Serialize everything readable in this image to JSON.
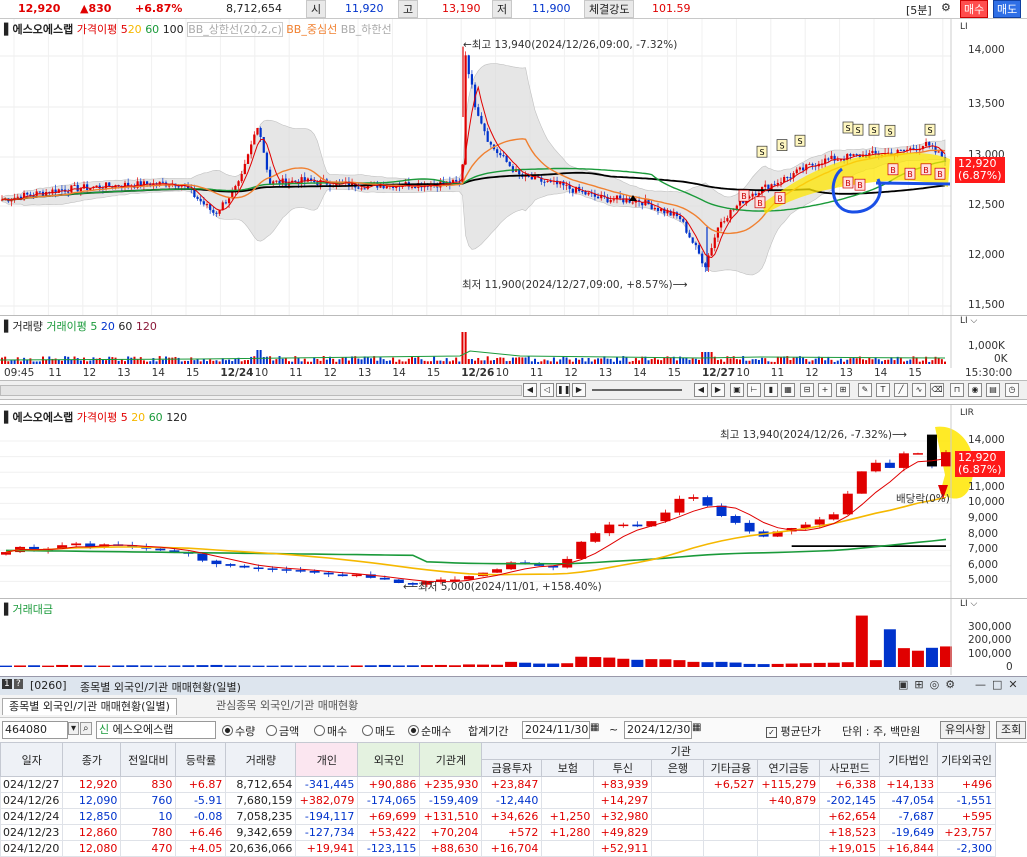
{
  "topbar": {
    "price": "12,920",
    "change": "▲830",
    "change_pct": "+6.87%",
    "volume": "8,712,654",
    "open_label": "시",
    "open": "11,920",
    "high_label": "고",
    "high": "13,190",
    "low_label": "저",
    "low": "11,900",
    "strength_label": "체결강도",
    "strength": "101.59",
    "period": "[5분]",
    "buy": "매수",
    "sell": "매도"
  },
  "chart1": {
    "legend": {
      "name": "에스오에스랩",
      "ma_label": "가격이평",
      "ma5": "5",
      "ma20": "20",
      "ma60": "60",
      "ma100": "100",
      "bb_upper": "BB_상한선(20,2,c)",
      "bb_mid": "BB_중심선",
      "bb_lower": "BB_하한선"
    },
    "max_note": "←최고 13,940(2024/12/26,09:00, -7.32%)",
    "min_note": "최저 11,900(2024/12/27,09:00, +8.57%)⟶",
    "price_box": [
      "12,920",
      "(6.87%)"
    ],
    "y_ticks": [
      "14,000",
      "13,500",
      "13,000",
      "12,500",
      "12,000",
      "11,500"
    ],
    "corner": "LI"
  },
  "vol1": {
    "legend": {
      "name": "거래량",
      "ma_label": "거래이평",
      "v5": "5",
      "v20": "20",
      "v60": "60",
      "v120": "120"
    },
    "y_ticks": [
      "1,000K",
      "0K"
    ],
    "x_ticks": [
      "09:45",
      "11",
      "12",
      "13",
      "14",
      "15",
      "12/24",
      "10",
      "11",
      "12",
      "13",
      "14",
      "15",
      "12/26",
      "10",
      "11",
      "12",
      "13",
      "14",
      "15",
      "12/27",
      "10",
      "11",
      "12",
      "13",
      "14",
      "15",
      "15:30:00"
    ]
  },
  "chart2": {
    "legend": {
      "name": "에스오에스랩",
      "ma_label": "가격이평",
      "ma5": "5",
      "ma20": "20",
      "ma60": "60",
      "ma120": "120"
    },
    "max_note": "최고 13,940(2024/12/26, -7.32%)⟶",
    "min_note": "⟵최저 5,000(2024/11/01, +158.40%)",
    "div_note": "배당락(0%)",
    "price_box": [
      "12,920",
      "(6.87%)"
    ],
    "y_ticks": [
      "14,000",
      "13,000",
      "12,000",
      "11,000",
      "10,000",
      "9,000",
      "8,000",
      "7,000",
      "6,000",
      "5,000"
    ],
    "corner": "LIR"
  },
  "vol2": {
    "legend": {
      "name": "거래대금"
    },
    "y_ticks": [
      "300,000",
      "200,000",
      "100,000",
      "0"
    ]
  },
  "chart_data": [
    {
      "type": "line",
      "title": "",
      "x": [
        "12/24",
        "12/26",
        "12/27"
      ],
      "series": [
        {
          "name": "가격이평 5",
          "values": [
            12620,
            12880,
            12900
          ]
        }
      ],
      "ylim": [
        11500,
        14100
      ],
      "high": 13940,
      "low": 11900,
      "last": 12920
    },
    {
      "type": "bar",
      "title": "",
      "x": [
        "2024/11/01",
        "2024/12/26",
        "2024/12/27"
      ],
      "series": [
        {
          "name": "거래대금",
          "values": [
            8000,
            300000,
            112000
          ]
        }
      ],
      "ylim": [
        0,
        350000
      ]
    }
  ],
  "panel": {
    "window_num": "[0260]",
    "window_title": "종목별 외국인/기관 매매현황(일별)",
    "tab1": "종목별 외국인/기관 매매현황(일별)",
    "tab2": "관심종목 외국인/기관 매매현황",
    "code": "464080",
    "code_tag": "신",
    "stock_name": "에스오에스랩",
    "radio_qty": "수량",
    "radio_amt": "금액",
    "radio_buy": "매수",
    "radio_sell": "매도",
    "radio_net": "순매수",
    "period_label": "합계기간",
    "date_from": "2024/11/30",
    "date_to": "2024/12/30",
    "avg_label": "평균단가",
    "unit": "단위 : 주, 백만원",
    "notice_btn": "유의사항",
    "query_btn": "조회"
  },
  "table": {
    "group_header": "기관",
    "headers": [
      "일자",
      "종가",
      "전일대비",
      "등락률",
      "거래량",
      "개인",
      "외국인",
      "기관계",
      "금융투자",
      "보험",
      "투신",
      "은행",
      "기타금융",
      "연기금등",
      "사모펀드",
      "기타법인",
      "기타외국인"
    ],
    "rows": [
      [
        "024/12/27",
        "12,920",
        "830",
        "+6.87",
        "8,712,654",
        "-341,445",
        "+90,886",
        "+235,930",
        "+23,847",
        "",
        "+83,939",
        "",
        "+6,527",
        "+115,279",
        "+6,338",
        "+14,133",
        "+496"
      ],
      [
        "024/12/26",
        "12,090",
        "760",
        "-5.91",
        "7,680,159",
        "+382,079",
        "-174,065",
        "-159,409",
        "-12,440",
        "",
        "+14,297",
        "",
        "",
        "+40,879",
        "-202,145",
        "-47,054",
        "-1,551"
      ],
      [
        "024/12/24",
        "12,850",
        "10",
        "-0.08",
        "7,058,235",
        "-194,117",
        "+69,699",
        "+131,510",
        "+34,626",
        "+1,250",
        "+32,980",
        "",
        "",
        "",
        "+62,654",
        "-7,687",
        "+595"
      ],
      [
        "024/12/23",
        "12,860",
        "780",
        "+6.46",
        "9,342,659",
        "-127,734",
        "+53,422",
        "+70,204",
        "+572",
        "+1,280",
        "+49,829",
        "",
        "",
        "",
        "+18,523",
        "-19,649",
        "+23,757"
      ],
      [
        "024/12/20",
        "12,080",
        "470",
        "+4.05",
        "20,636,066",
        "+19,941",
        "-123,115",
        "+88,630",
        "+16,704",
        "",
        "+52,911",
        "",
        "",
        "",
        "+19,015",
        "+16,844",
        "-2,300"
      ]
    ]
  },
  "colors": {
    "up": "#e00000",
    "down": "#0033cc",
    "ma5": "#e00000",
    "ma20": "#f5b800",
    "ma60": "#1a9a3a",
    "ma100": "#000000",
    "bb": "#d9d9d9"
  }
}
